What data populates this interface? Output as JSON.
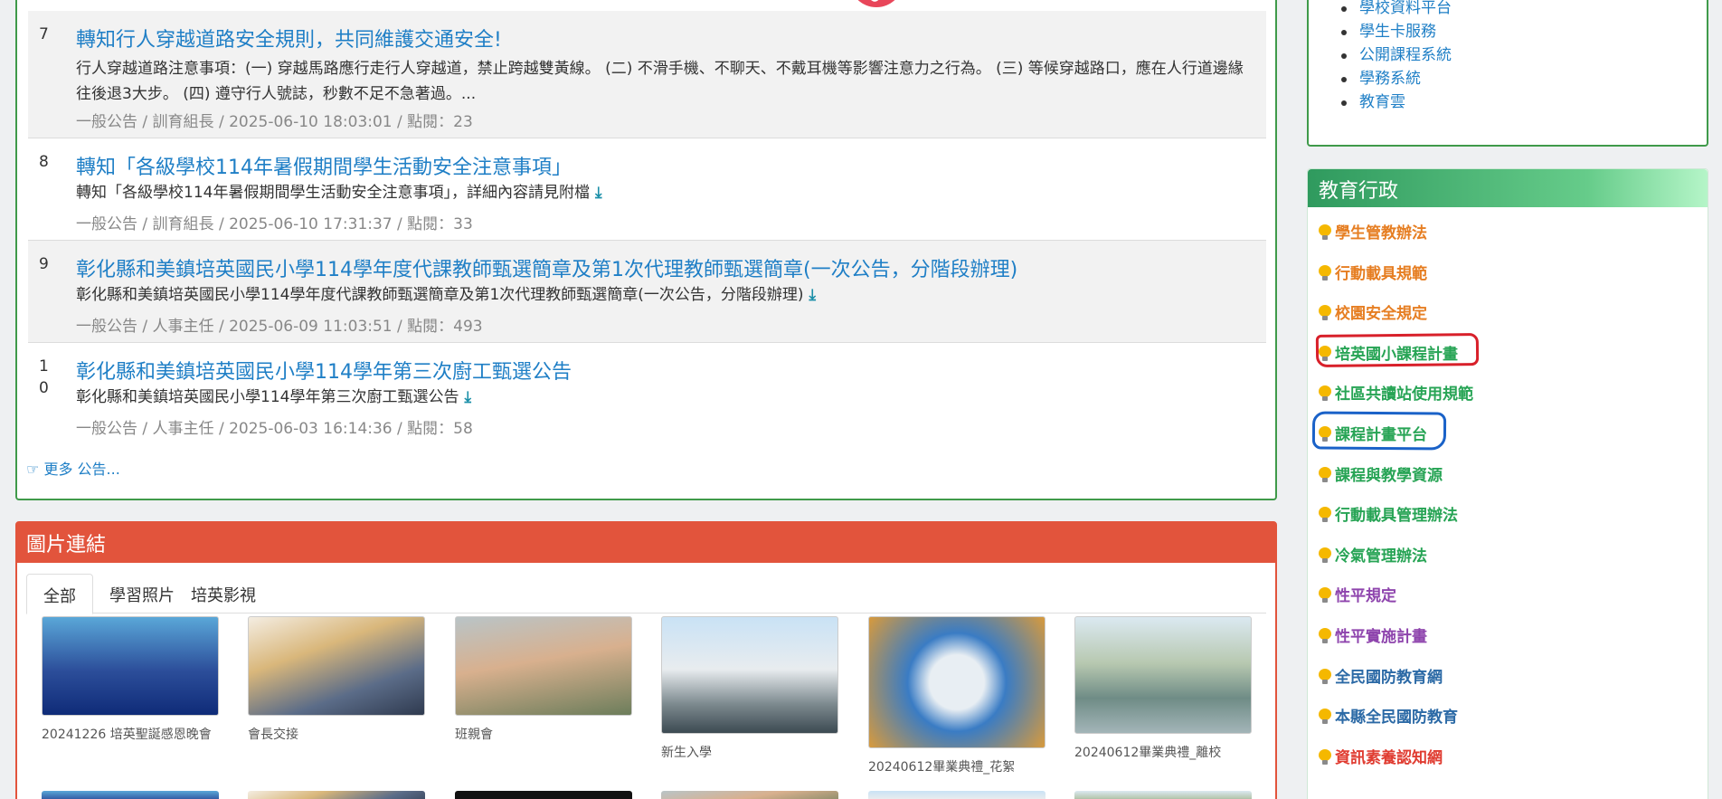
{
  "announcements": [
    {
      "number": "7",
      "title": "轉知行人穿越道路安全規則，共同維護交通安全!",
      "body": "行人穿越道路注意事項：(一) 穿越馬路應行走行人穿越道，禁止跨越雙黃線。 (二) 不滑手機、不聊天、不戴耳機等影響注意力之行為。 (三) 等候穿越路口，應在人行道邊緣往後退3大步。 (四) 遵守行人號誌，秒數不足不急著過。...",
      "meta": "一般公告 / 訓育組長 / 2025-06-10 18:03:01 / 點閱：23"
    },
    {
      "number": "8",
      "title": "轉知「各級學校114年暑假期間學生活動安全注意事項」",
      "body": "轉知「各級學校114年暑假期間學生活動安全注意事項」，詳細內容請見附檔",
      "meta": "一般公告 / 訓育組長 / 2025-06-10 17:31:37 / 點閱：33"
    },
    {
      "number": "9",
      "title": "彰化縣和美鎮培英國民小學114學年度代課教師甄選簡章及第1次代理教師甄選簡章(一次公告，分階段辦理)",
      "body": "彰化縣和美鎮培英國民小學114學年度代課教師甄選簡章及第1次代理教師甄選簡章(一次公告，分階段辦理)",
      "meta": "一般公告 / 人事主任 / 2025-06-09 11:03:51 / 點閱：493"
    },
    {
      "number": "10",
      "title": "彰化縣和美鎮培英國民小學114學年第三次廚工甄選公告",
      "body": "彰化縣和美鎮培英國民小學114學年第三次廚工甄選公告",
      "meta": "一般公告 / 人事主任 / 2025-06-03 16:14:36 / 點閱：58"
    }
  ],
  "more_link": "更多 公告...",
  "image_links": {
    "title": "圖片連結",
    "tabs": [
      "全部",
      "學習照片",
      "培英影視"
    ],
    "photos": [
      {
        "caption": "20241226 培英聖誕感恩晚會"
      },
      {
        "caption": "會長交接"
      },
      {
        "caption": "班親會"
      },
      {
        "caption": "新生入學"
      },
      {
        "caption": "20240612畢業典禮_花絮"
      },
      {
        "caption": "20240612畢業典禮_離校"
      }
    ]
  },
  "systems": {
    "items": [
      "學校資料平台",
      "學生卡服務",
      "公開課程系統",
      "學務系統",
      "教育雲"
    ]
  },
  "edu_admin": {
    "title": "教育行政",
    "items": [
      {
        "label": "學生管教辦法",
        "color": "#e67e22"
      },
      {
        "label": "行動載具規範",
        "color": "#e67e22"
      },
      {
        "label": "校園安全規定",
        "color": "#e67e22"
      },
      {
        "label": "培英國小課程計畫",
        "color": "#27a455"
      },
      {
        "label": "社區共讀站使用規範",
        "color": "#27a455"
      },
      {
        "label": "課程計畫平台",
        "color": "#27a455"
      },
      {
        "label": "課程與教學資源",
        "color": "#27a455"
      },
      {
        "label": "行動載具管理辦法",
        "color": "#27a455"
      },
      {
        "label": "冷氣管理辦法",
        "color": "#27a455"
      },
      {
        "label": "性平規定",
        "color": "#8e44ad"
      },
      {
        "label": "性平實施計畫",
        "color": "#8e44ad"
      },
      {
        "label": "全民國防教育網",
        "color": "#2c6aa6"
      },
      {
        "label": "本縣全民國防教育",
        "color": "#2c6aa6"
      },
      {
        "label": "資訊素養認知網",
        "color": "#e03c31"
      }
    ]
  }
}
